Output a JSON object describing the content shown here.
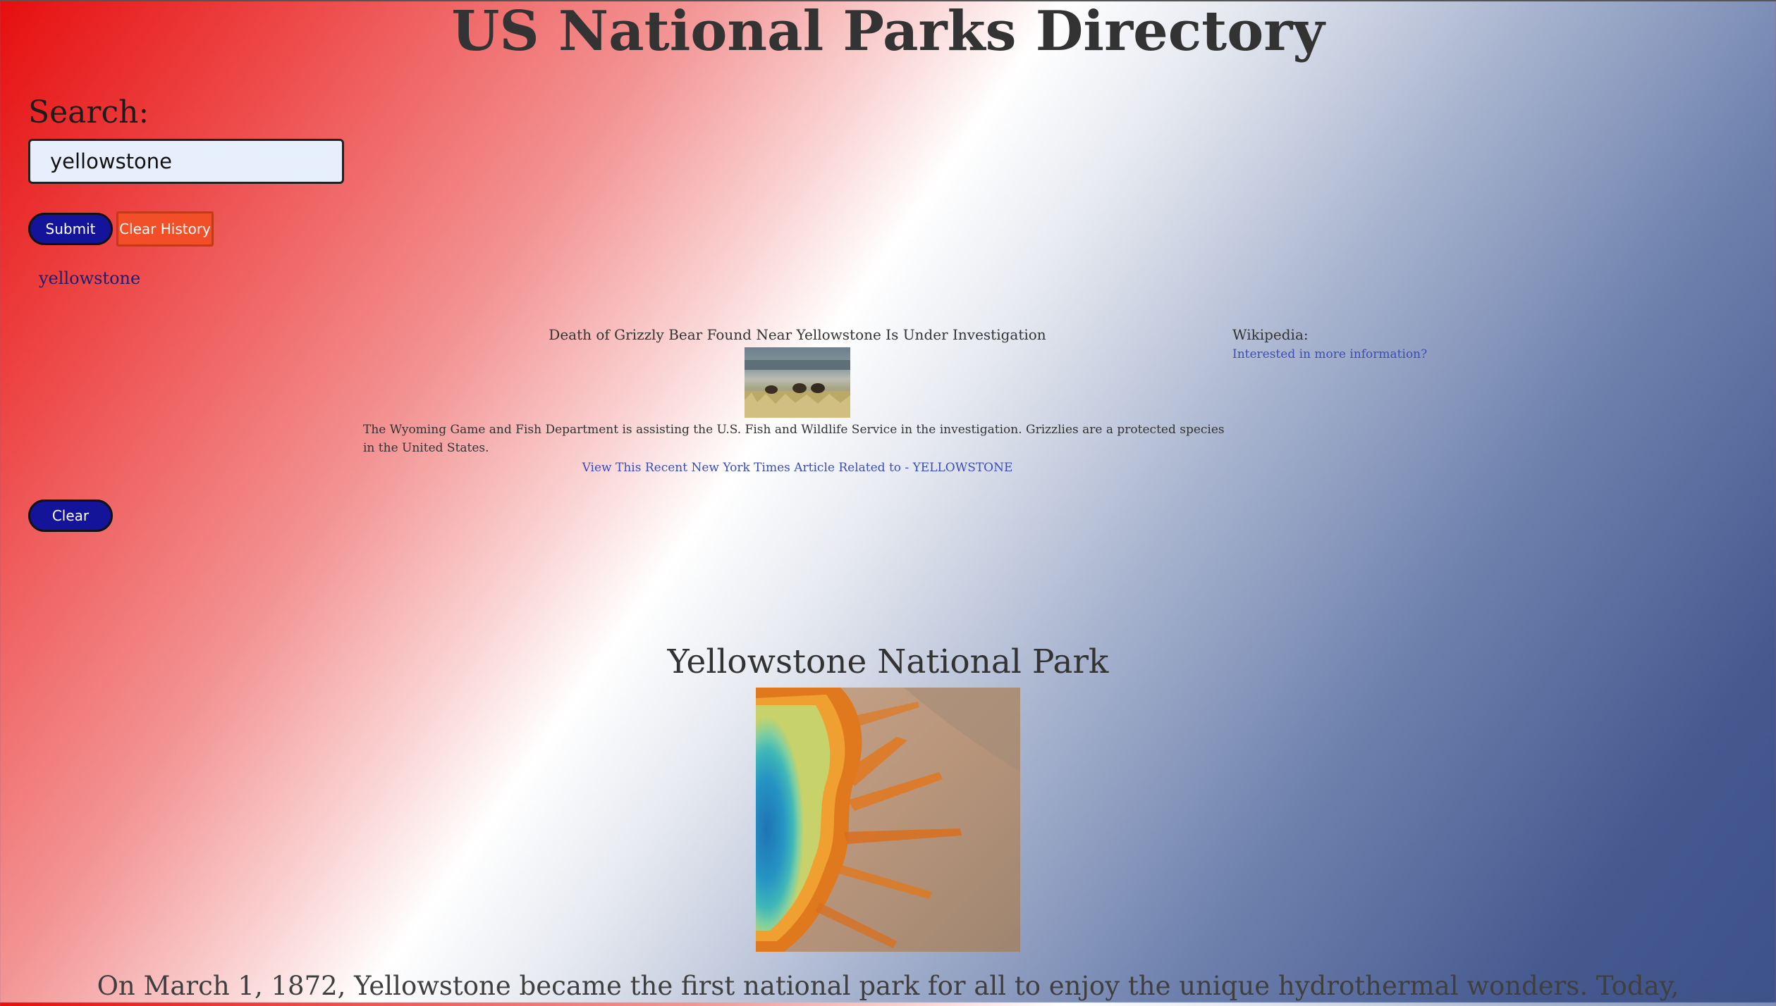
{
  "header": {
    "title": "US National Parks Directory"
  },
  "search": {
    "label": "Search:",
    "value": "yellowstone",
    "submit_label": "Submit",
    "clear_history_label": "Clear History",
    "clear_label": "Clear"
  },
  "history": {
    "items": [
      "yellowstone"
    ]
  },
  "news": {
    "headline": "Death of Grizzly Bear Found Near Yellowstone Is Under Investigation",
    "abstract": "The Wyoming Game and Fish Department is assisting the U.S. Fish and Wildlife Service in the investigation. Grizzlies are a protected species in the United States.",
    "link_text": "View This Recent New York Times Article Related to - YELLOWSTONE"
  },
  "wiki": {
    "label": "Wikipedia:",
    "link_text": "Interested in more information?"
  },
  "park": {
    "title": "Yellowstone National Park",
    "description": "On March 1, 1872, Yellowstone became the first national park for all to enjoy the unique hydrothermal wonders. Today,"
  },
  "colors": {
    "button_primary": "#14149a",
    "button_clear_history": "#f24e28",
    "link": "#3b4db6"
  }
}
